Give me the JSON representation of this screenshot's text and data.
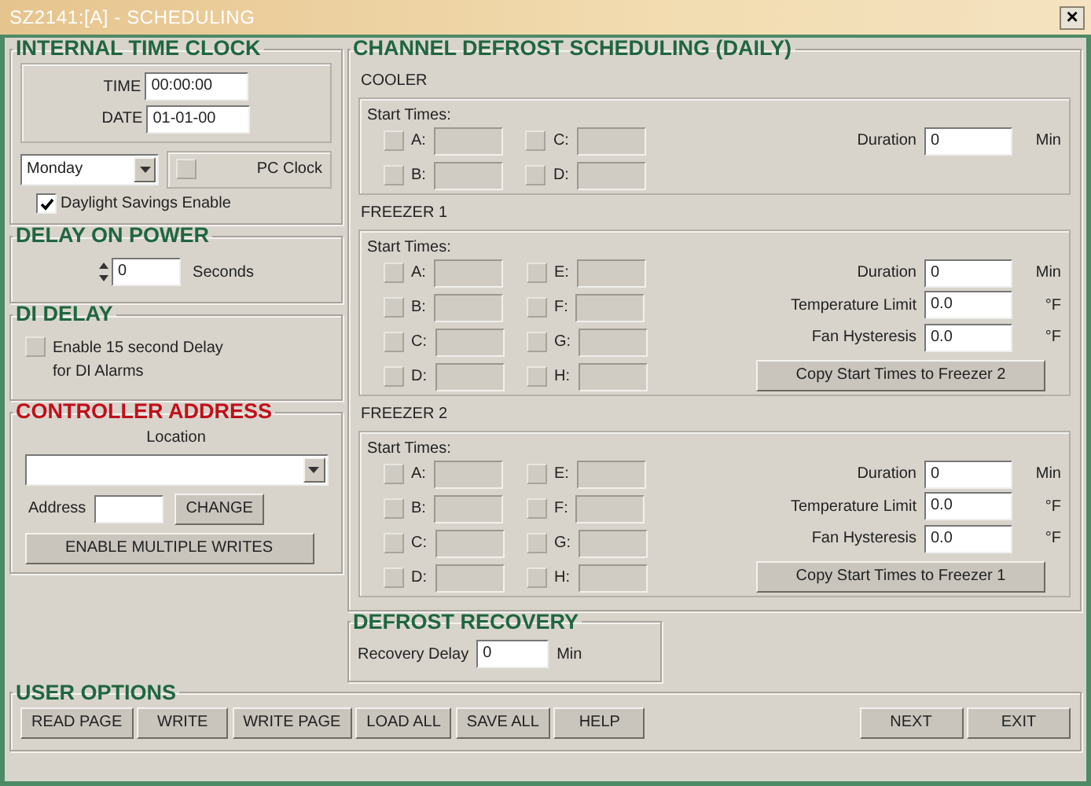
{
  "window": {
    "title": "SZ2141:[A] - SCHEDULING",
    "close": "×"
  },
  "clock": {
    "heading": "INTERNAL TIME CLOCK",
    "highlighted": false,
    "time_label": "TIME",
    "time": "00:00:00",
    "date_label": "DATE",
    "date": "01-01-00",
    "day": "Monday",
    "pc_clock": {
      "label": "PC Clock",
      "checked": false
    },
    "daylight": {
      "label": "Daylight Savings Enable",
      "checked": true
    }
  },
  "delay_on_power": {
    "heading": "DELAY ON POWER",
    "highlighted": false,
    "value": "0",
    "unit": "Seconds"
  },
  "di_delay": {
    "heading": "DI DELAY",
    "highlighted": false,
    "label": "Enable 15 second Delay for DI Alarms",
    "checked": false
  },
  "controller_address": {
    "heading": "CONTROLLER ADDRESS",
    "highlighted": true,
    "location_label": "Location",
    "address_label": "Address",
    "change_button": "CHANGE",
    "multiple_writes_button": "ENABLE MULTIPLE WRITES"
  },
  "defrost": {
    "heading": "CHANNEL DEFROST SCHEDULING (DAILY)",
    "highlighted": false,
    "channels": [
      {
        "name": "COOLER",
        "start_label": "Start Times:",
        "slots": [
          {
            "label": "A:",
            "checked": false
          },
          {
            "label": "B:",
            "checked": false
          },
          {
            "label": "C:",
            "checked": false
          },
          {
            "label": "D:",
            "checked": false
          }
        ],
        "fields": [
          {
            "label": "Duration",
            "value": "0",
            "unit": "Min"
          }
        ]
      },
      {
        "name": "FREEZER 1",
        "start_label": "Start Times:",
        "slots": [
          {
            "label": "A:",
            "checked": false
          },
          {
            "label": "B:",
            "checked": false
          },
          {
            "label": "C:",
            "checked": false
          },
          {
            "label": "D:",
            "checked": false
          },
          {
            "label": "E:",
            "checked": false
          },
          {
            "label": "F:",
            "checked": false
          },
          {
            "label": "G:",
            "checked": false
          },
          {
            "label": "H:",
            "checked": false
          }
        ],
        "fields": [
          {
            "label": "Duration",
            "value": "0",
            "unit": "Min"
          },
          {
            "label": "Temperature Limit",
            "value": "0.0",
            "unit": "°F"
          },
          {
            "label": "Fan Hysteresis",
            "value": "0.0",
            "unit": "°F"
          }
        ],
        "copy_button": "Copy Start Times to Freezer 2"
      },
      {
        "name": "FREEZER 2",
        "start_label": "Start Times:",
        "slots": [
          {
            "label": "A:",
            "checked": false
          },
          {
            "label": "B:",
            "checked": false
          },
          {
            "label": "C:",
            "checked": false
          },
          {
            "label": "D:",
            "checked": false
          },
          {
            "label": "E:",
            "checked": false
          },
          {
            "label": "F:",
            "checked": false
          },
          {
            "label": "G:",
            "checked": false
          },
          {
            "label": "H:",
            "checked": false
          }
        ],
        "fields": [
          {
            "label": "Duration",
            "value": "0",
            "unit": "Min"
          },
          {
            "label": "Temperature Limit",
            "value": "0.0",
            "unit": "°F"
          },
          {
            "label": "Fan Hysteresis",
            "value": "0.0",
            "unit": "°F"
          }
        ],
        "copy_button": "Copy Start Times to Freezer 1"
      }
    ]
  },
  "defrost_recovery": {
    "heading": "DEFROST RECOVERY",
    "highlighted": false,
    "label": "Recovery Delay",
    "value": "0",
    "unit": "Min"
  },
  "user_options": {
    "heading": "USER OPTIONS",
    "highlighted": false,
    "buttons": [
      "READ PAGE",
      "WRITE",
      "WRITE PAGE",
      "LOAD ALL",
      "SAVE ALL",
      "HELP"
    ],
    "right_buttons": [
      "NEXT",
      "EXIT"
    ]
  }
}
